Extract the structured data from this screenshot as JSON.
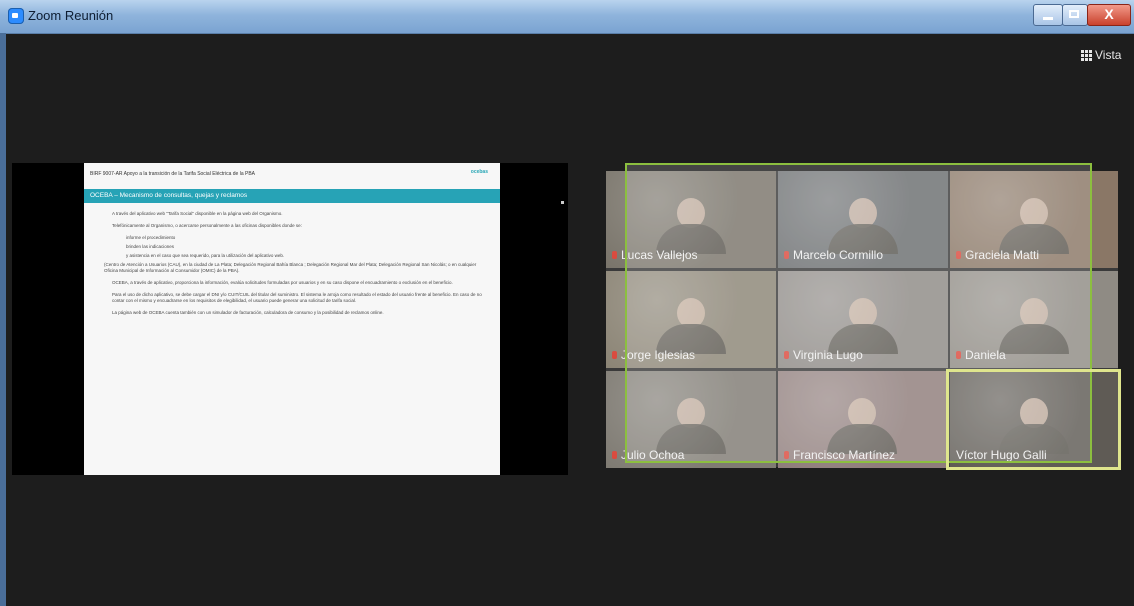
{
  "window": {
    "title": "Zoom Reunión",
    "close_label": "X"
  },
  "toolbar": {
    "view_label": "Vista",
    "view_icon": "grid-icon"
  },
  "slide": {
    "header": "BIRF 9007-AR Apoyo a la transición de la Tarifa Social Eléctrica de la PBA",
    "logo": "ocebas",
    "section_title": "OCEBA – Mecanismo de consultas, quejas y reclamos",
    "lines": [
      "A través del aplicativo web \"Tarifa Social\" disponible en la página web del Organismo.",
      "Telefónicamente al Organismo, o acercarse personalmente a las oficinas disponibles donde se:",
      "informe el procedimiento",
      "brinden las indicaciones",
      "y asistencia en el caso que sea requerido, para la utilización del aplicativo web.",
      "(Centro de Atención a Usuarios (CAU), en la ciudad de La Plata; Delegación Regional Bahía Blanca ; Delegación Regional Mar del Plata; Delegación Regional San Nicolás; o en cualquier Oficina Municipal de Información al Consumidor (OMIC) de la PBA).",
      "OCEBA, a través de aplicativo, proporciona la información, evalúa solicitudes formuladas por usuarios y en su caso dispone el encuadramiento o exclusión en el beneficio.",
      "Para el uso de dicho aplicativo, se debe cargar el DNI y/o CUIT/CUIL del titular del suministro. El sistema le arroja como resultado el estado del usuario frente al beneficio. En caso de no contar con el mismo y encuadrarse en los requisitos de elegibilidad, el usuario puede generar una solicitud de tarifa social.",
      "La página web de OCEBA cuenta también con un simulador de facturación, calculadora de consumo y la posibilidad de reclamos online."
    ]
  },
  "participants": [
    {
      "name": "Lucas Vallejos"
    },
    {
      "name": "Marcelo Cormillo"
    },
    {
      "name": "Graciela Matti"
    },
    {
      "name": "Jorge Iglesias"
    },
    {
      "name": "Virginia Lugo"
    },
    {
      "name": "Daniela"
    },
    {
      "name": "Julio Ochoa"
    },
    {
      "name": "Francisco Martínez"
    },
    {
      "name": "Víctor Hugo Galli"
    }
  ],
  "colors": {
    "active_speaker": "#8cbf3f",
    "highlight": "#dfe58d",
    "slide_accent": "#27a3b6"
  }
}
